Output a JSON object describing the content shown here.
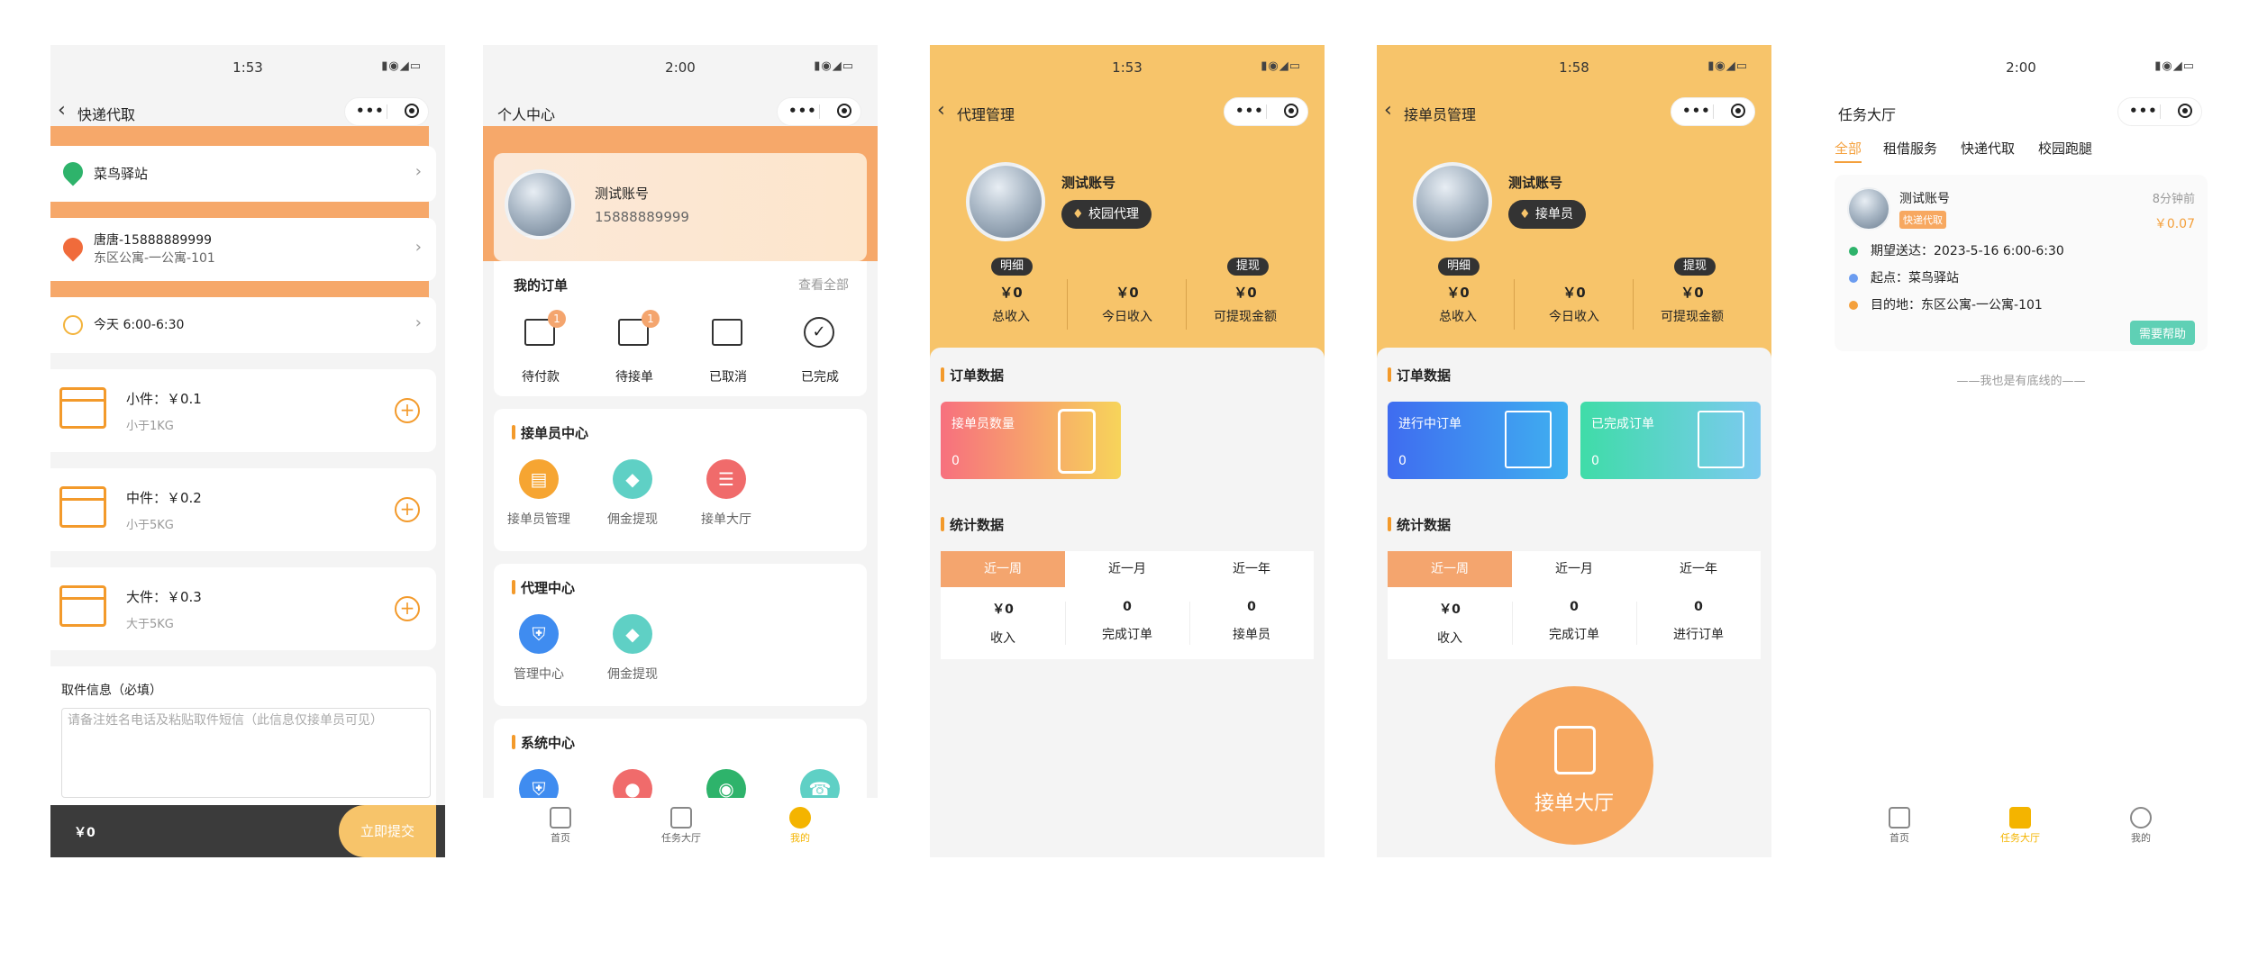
{
  "screen1": {
    "time": "1:53",
    "title": "快递代取",
    "station": "菜鸟驿站",
    "address_name": "唐唐-15888889999",
    "address_detail": "东区公寓-一公寓-101",
    "time_slot": "今天 6:00-6:30",
    "items": [
      {
        "name": "小件：￥0.1",
        "desc": "小于1KG"
      },
      {
        "name": "中件：￥0.2",
        "desc": "小于5KG"
      },
      {
        "name": "大件：￥0.3",
        "desc": "大于5KG"
      }
    ],
    "info_label": "取件信息（必填）",
    "info_placeholder": "请备注姓名电话及粘贴取件短信（此信息仅接单员可见）",
    "total": "￥0",
    "submit": "立即提交"
  },
  "screen2": {
    "time": "2:00",
    "title": "个人中心",
    "name": "测试账号",
    "phone": "15888889999",
    "orders_title": "我的订单",
    "view_all": "查看全部",
    "orders": [
      {
        "label": "待付款",
        "badge": "1"
      },
      {
        "label": "待接单",
        "badge": "1"
      },
      {
        "label": "已取消",
        "badge": ""
      },
      {
        "label": "已完成",
        "badge": ""
      }
    ],
    "taker_title": "接单员中心",
    "taker_items": [
      "接单员管理",
      "佣金提现",
      "接单大厅"
    ],
    "agent_title": "代理中心",
    "agent_items": [
      "管理中心",
      "佣金提现"
    ],
    "system_title": "系统中心",
    "tabs": [
      "首页",
      "任务大厅",
      "我的"
    ]
  },
  "screen3": {
    "time": "1:53",
    "title": "代理管理",
    "name": "测试账号",
    "role": "校园代理",
    "detail": "明细",
    "withdraw": "提现",
    "stats": [
      {
        "value": "￥0",
        "label": "总收入"
      },
      {
        "value": "￥0",
        "label": "今日收入"
      },
      {
        "value": "￥0",
        "label": "可提现金额"
      }
    ],
    "order_data": "订单数据",
    "card": {
      "title": "接单员数量",
      "value": "0"
    },
    "stat_data": "统计数据",
    "periods": [
      "近一周",
      "近一月",
      "近一年"
    ],
    "bottom": [
      {
        "value": "￥0",
        "label": "收入"
      },
      {
        "value": "0",
        "label": "完成订单"
      },
      {
        "value": "0",
        "label": "接单员"
      }
    ]
  },
  "screen4": {
    "time": "1:58",
    "title": "接单员管理",
    "name": "测试账号",
    "role": "接单员",
    "detail": "明细",
    "withdraw": "提现",
    "stats": [
      {
        "value": "￥0",
        "label": "总收入"
      },
      {
        "value": "￥0",
        "label": "今日收入"
      },
      {
        "value": "￥0",
        "label": "可提现金额"
      }
    ],
    "order_data": "订单数据",
    "cards": [
      {
        "title": "进行中订单",
        "value": "0"
      },
      {
        "title": "已完成订单",
        "value": "0"
      }
    ],
    "stat_data": "统计数据",
    "periods": [
      "近一周",
      "近一月",
      "近一年"
    ],
    "bottom": [
      {
        "value": "￥0",
        "label": "收入"
      },
      {
        "value": "0",
        "label": "完成订单"
      },
      {
        "value": "0",
        "label": "进行订单"
      }
    ],
    "hall_button": "接单大厅"
  },
  "screen5": {
    "time": "2:00",
    "title": "任务大厅",
    "filters": [
      "全部",
      "租借服务",
      "快递代取",
      "校园跑腿"
    ],
    "task": {
      "user": "测试账号",
      "tag": "快递代取",
      "ago": "8分钟前",
      "price": "￥0.07",
      "expect": "期望送达：2023-5-16 6:00-6:30",
      "start": "起点：菜鸟驿站",
      "dest": "目的地：东区公寓-一公寓-101",
      "help": "需要帮助"
    },
    "end_text": "——我也是有底线的——",
    "tabs": [
      "首页",
      "任务大厅",
      "我的"
    ]
  }
}
